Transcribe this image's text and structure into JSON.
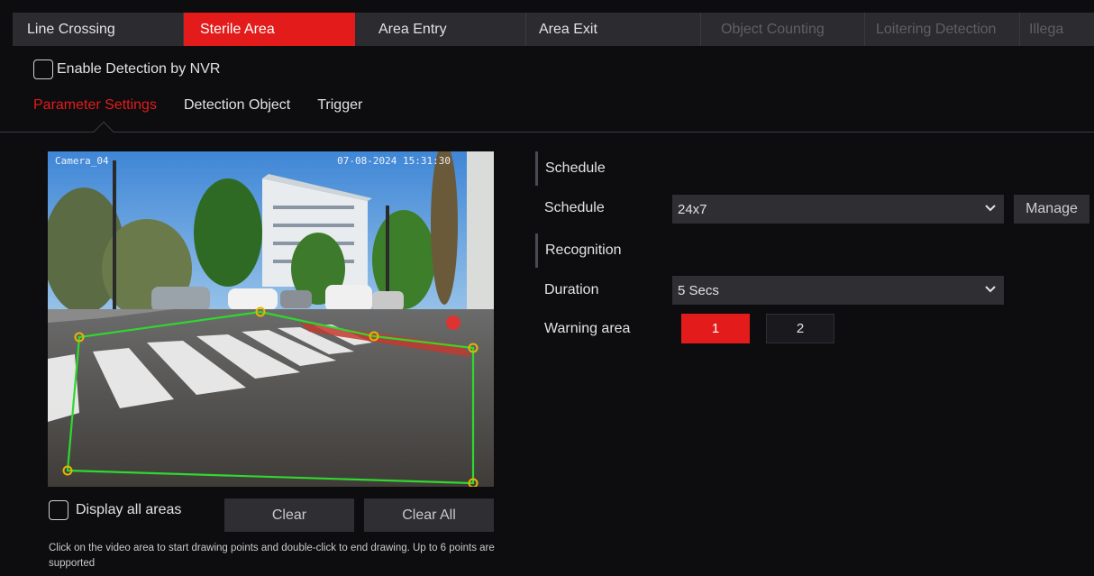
{
  "main_tabs": [
    {
      "label": "Line Crossing",
      "state": "normal"
    },
    {
      "label": "Sterile Area",
      "state": "active"
    },
    {
      "label": "Area Entry",
      "state": "normal"
    },
    {
      "label": "Area Exit",
      "state": "normal"
    },
    {
      "label": "Object Counting",
      "state": "disabled"
    },
    {
      "label": "Loitering Detection",
      "state": "disabled"
    },
    {
      "label": "Illega",
      "state": "disabled"
    }
  ],
  "enable_detection": {
    "label": "Enable Detection by NVR",
    "checked": false
  },
  "sub_tabs": [
    {
      "label": "Parameter Settings",
      "active": true
    },
    {
      "label": "Detection Object",
      "active": false
    },
    {
      "label": "Trigger",
      "active": false
    }
  ],
  "video": {
    "osd_left": "Camera_04",
    "osd_right": "07-08-2024 15:31:30",
    "polygon_color": "#2fd82f",
    "point_color": "#e8b400"
  },
  "display_all_areas": {
    "label": "Display all areas",
    "checked": false
  },
  "buttons": {
    "clear": "Clear",
    "clear_all": "Clear All",
    "manage": "Manage"
  },
  "hint": "Click on the video area to start drawing points and double-click to end drawing. Up to 6 points are supported",
  "schedule_section": {
    "title": "Schedule",
    "label": "Schedule",
    "value": "24x7"
  },
  "recognition_section": {
    "title": "Recognition",
    "duration_label": "Duration",
    "duration_value": "5 Secs",
    "warning_label": "Warning area",
    "warning_areas": [
      "1",
      "2"
    ],
    "active_warning_area": "1"
  },
  "colors": {
    "accent": "#e41b1b",
    "background": "#0d0d0f",
    "panel": "#2e2e33"
  }
}
